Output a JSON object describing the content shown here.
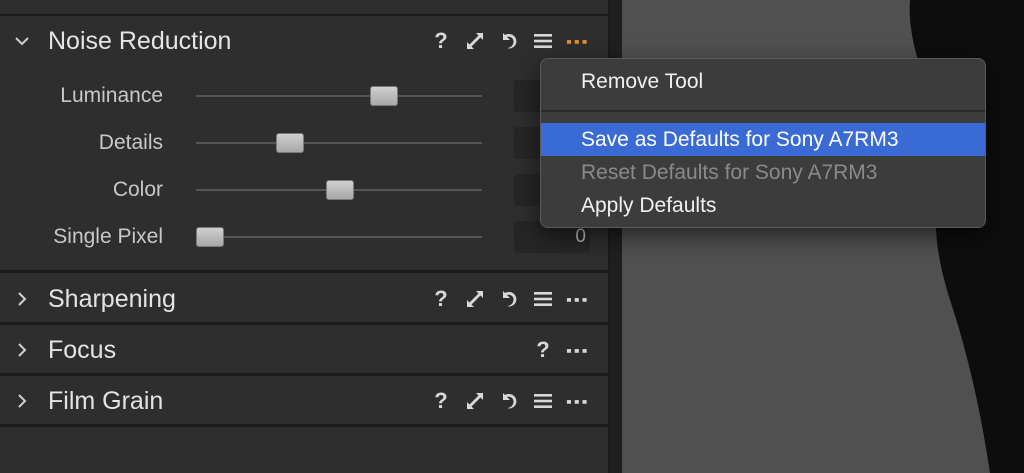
{
  "tools": {
    "noise_reduction": {
      "title": "Noise Reduction",
      "expanded": true,
      "sliders": [
        {
          "label": "Luminance",
          "value": 0.6,
          "display": ""
        },
        {
          "label": "Details",
          "value": 0.3,
          "display": ""
        },
        {
          "label": "Color",
          "value": 0.5,
          "display": ""
        },
        {
          "label": "Single Pixel",
          "value": 0.0,
          "display": "0"
        }
      ]
    },
    "sharpening": {
      "title": "Sharpening"
    },
    "focus": {
      "title": "Focus"
    },
    "film_grain": {
      "title": "Film Grain"
    }
  },
  "icons": {
    "help": "?",
    "expand": "expand-icon",
    "reset": "reset-icon",
    "presets": "presets-menu-icon",
    "more": "more-icon"
  },
  "colors": {
    "accent_more": "#e8902a",
    "selection": "#3a6bd4"
  },
  "menu": {
    "items": [
      {
        "label": "Remove Tool",
        "state": "normal"
      },
      {
        "label": "Save as Defaults for Sony A7RM3",
        "state": "selected"
      },
      {
        "label": "Reset Defaults for Sony A7RM3",
        "state": "disabled"
      },
      {
        "label": "Apply Defaults",
        "state": "normal"
      }
    ]
  }
}
